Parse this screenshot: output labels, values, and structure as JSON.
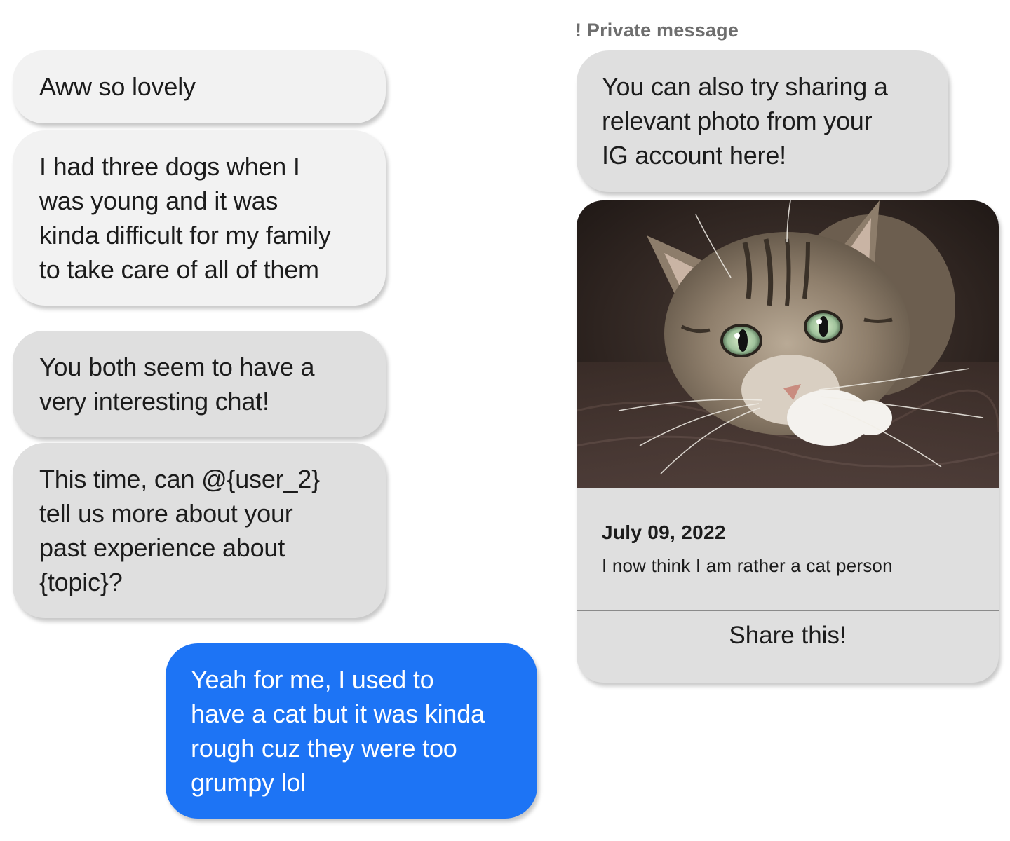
{
  "left_messages": [
    {
      "text": "Aww so lovely"
    },
    {
      "text": "I had three dogs when I\nwas young and it was\nkinda difficult for my family\nto take care of all of them"
    },
    {
      "text": "You both seem to have a\nvery interesting chat!"
    },
    {
      "text": "This time, can @{user_2}\ntell us more about your\npast experience about\n{topic}?"
    }
  ],
  "user_message": {
    "text": "Yeah for me, I used to\nhave a cat but it was kinda\nrough cuz they were too\ngrumpy lol",
    "color": "#1d74f5"
  },
  "private_message": {
    "label": "! Private message",
    "text": "You can also try sharing a\nrelevant photo from your\nIG account here!"
  },
  "ig_card": {
    "photo": "tabby-cat-photo",
    "date": "July 09, 2022",
    "caption": "I now think I am rather a cat person",
    "share_label": "Share this!"
  }
}
